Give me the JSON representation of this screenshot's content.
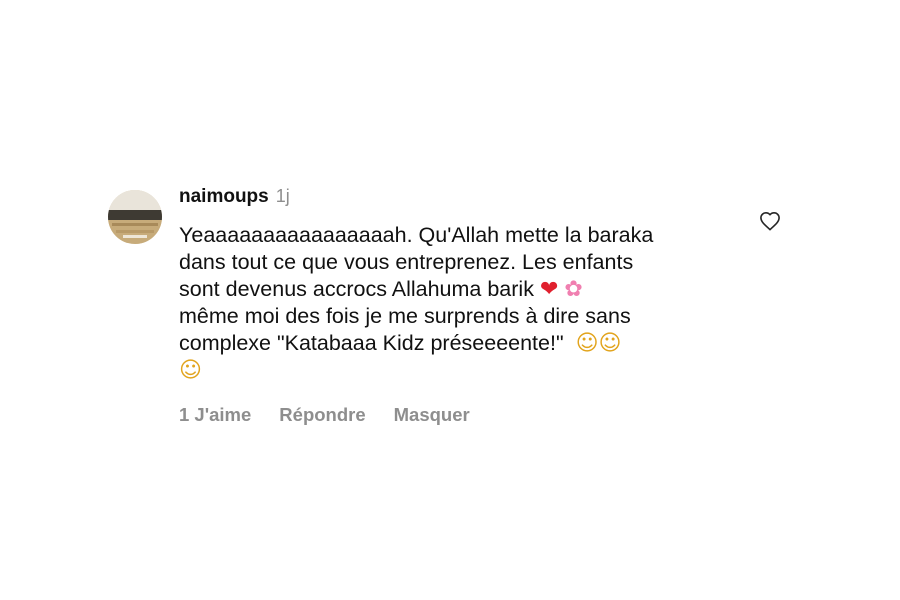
{
  "comment": {
    "username": "naimoups",
    "time": "1j",
    "text_line1": "Yeaaaaaaaaaaaaaaaah. Qu'Allah mette la baraka",
    "text_line2": "dans tout ce que vous entreprenez. Les enfants",
    "text_line3": "sont devenus accrocs Allahuma barik",
    "text_line4": "même moi des fois je me surprends à dire sans",
    "text_line5": "complexe \"Katabaaa Kidz préseeeente!\"",
    "emojis": {
      "heart": "❤",
      "flower": "✿",
      "laugh": "☺"
    },
    "actions": {
      "likes": "1 J'aime",
      "reply": "Répondre",
      "hide": "Masquer"
    }
  },
  "icons": {
    "like": "heart-outline-icon",
    "avatar": "user-avatar"
  },
  "colors": {
    "muted": "#8e8e8e",
    "text": "#111111",
    "heart": "#e0202e"
  }
}
